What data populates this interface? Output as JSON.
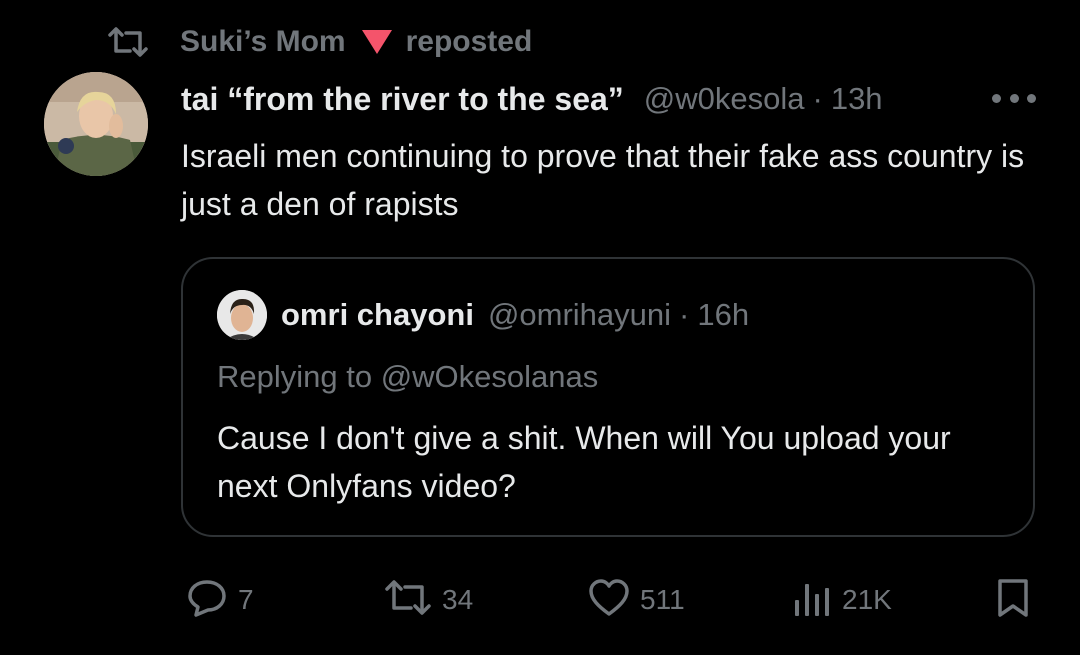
{
  "repost": {
    "icon": "repost-icon",
    "by": "Suki’s Mom",
    "label": "reposted",
    "accent": "#f4546b"
  },
  "post": {
    "avatar": "user-avatar",
    "name": "tai “from the river to the sea”",
    "handle": "@w0kesola",
    "separator": "·",
    "time": "13h",
    "more_icon": "more-icon",
    "text": "Israeli men continuing to prove that their fake ass country is just a den of rapists"
  },
  "quote": {
    "avatar": "quoted-user-avatar",
    "name": "omri chayoni",
    "handle": "@omrihayuni",
    "separator": "·",
    "time": "16h",
    "replying": "Replying to @wOkesolanas",
    "text": "Cause I don't give a shit. When will You upload your next Onlyfans video?"
  },
  "actions": {
    "reply": {
      "icon": "reply-icon",
      "count": "7"
    },
    "repost": {
      "icon": "repost-icon",
      "count": "34"
    },
    "like": {
      "icon": "heart-icon",
      "count": "511"
    },
    "views": {
      "icon": "views-icon",
      "count": "21K"
    },
    "bookmark": {
      "icon": "bookmark-icon"
    }
  },
  "colors": {
    "background": "#000000",
    "primary_text": "#e7e9ea",
    "secondary_text": "#71767b",
    "border": "#2f3336"
  }
}
